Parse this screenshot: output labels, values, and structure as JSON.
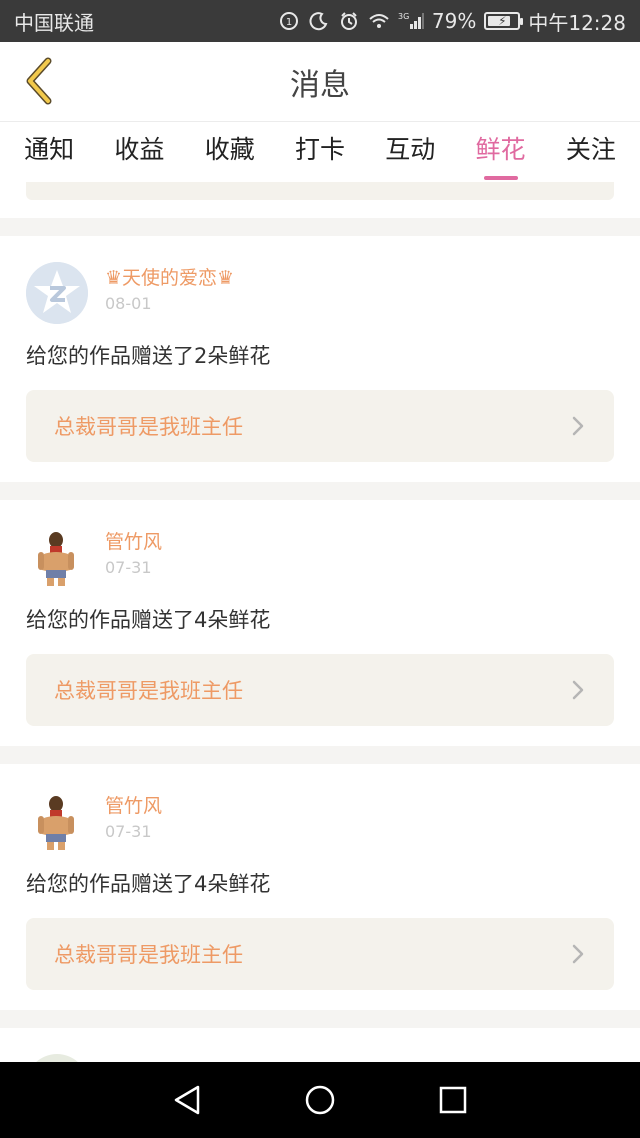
{
  "status_bar": {
    "carrier": "中国联通",
    "network": "3G",
    "battery": "79%",
    "battery_level": 0.79,
    "time": "中午12:28"
  },
  "header": {
    "title": "消息",
    "back_icon": "chevron-left-icon"
  },
  "tabs": [
    {
      "label": "通知",
      "active": false
    },
    {
      "label": "收益",
      "active": false
    },
    {
      "label": "收藏",
      "active": false
    },
    {
      "label": "打卡",
      "active": false
    },
    {
      "label": "互动",
      "active": false
    },
    {
      "label": "鲜花",
      "active": true
    },
    {
      "label": "关注",
      "active": false
    }
  ],
  "messages": [
    {
      "username": "♛天使的爱恋♛",
      "date": "08-01",
      "avatar": "qq-avatar",
      "text": "给您的作品赠送了2朵鲜花",
      "work_title": "总裁哥哥是我班主任"
    },
    {
      "username": "管竹风",
      "date": "07-31",
      "avatar": "person-avatar",
      "text": "给您的作品赠送了4朵鲜花",
      "work_title": "总裁哥哥是我班主任"
    },
    {
      "username": "管竹风",
      "date": "07-31",
      "avatar": "person-avatar",
      "text": "给您的作品赠送了4朵鲜花",
      "work_title": "总裁哥哥是我班主任"
    }
  ],
  "colors": {
    "accent": "#e06aa0",
    "username": "#ee9a65",
    "back_arrow": "#e8b83a"
  },
  "navbar": {
    "back": "triangle-back-icon",
    "home": "circle-home-icon",
    "recents": "square-recents-icon"
  }
}
